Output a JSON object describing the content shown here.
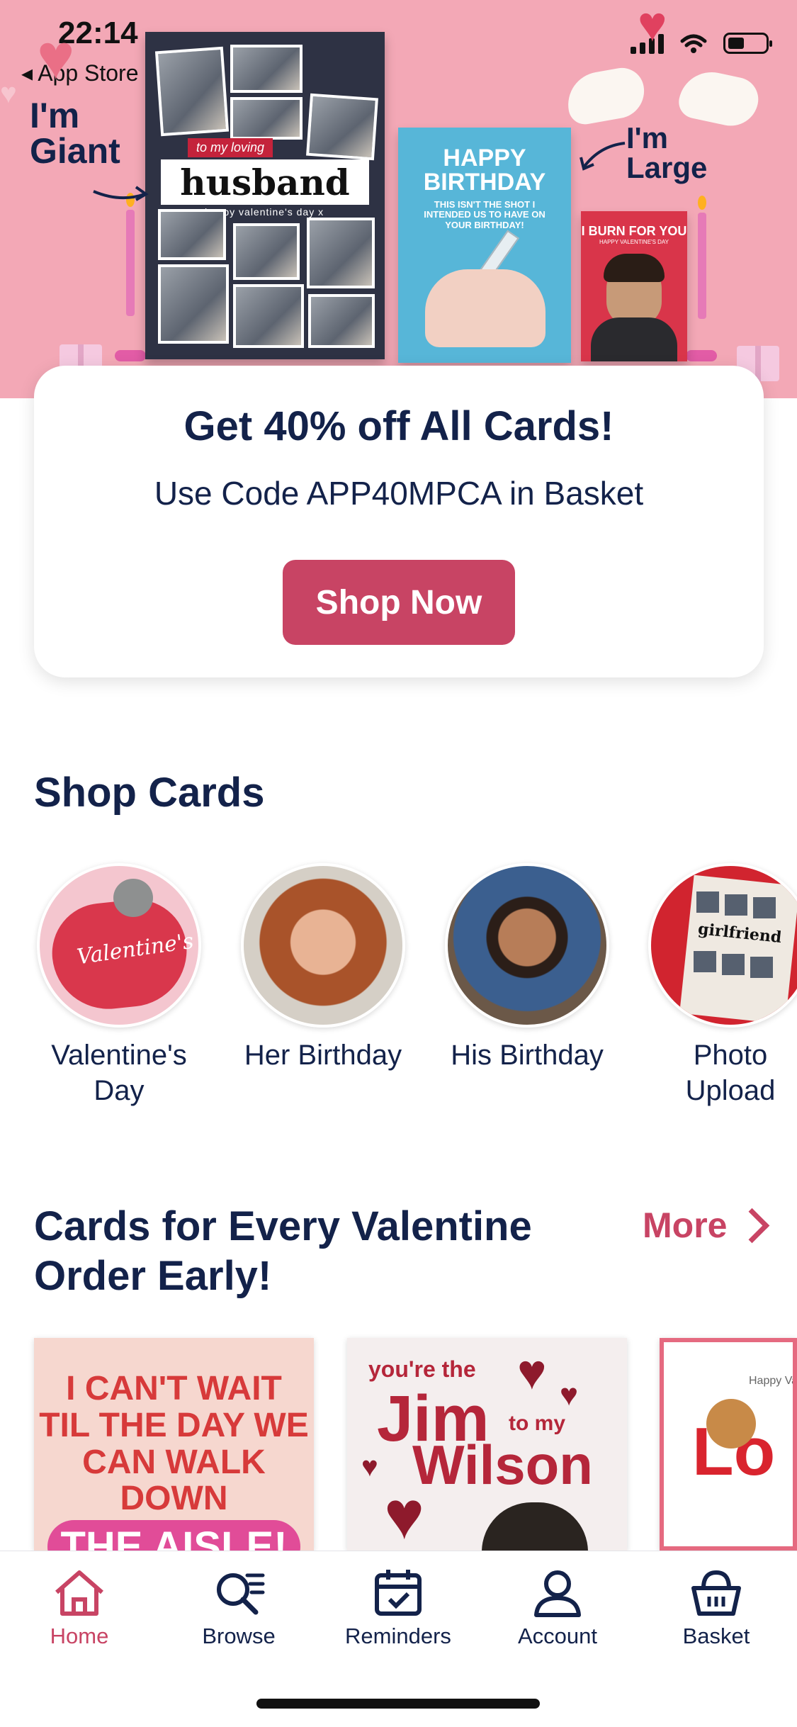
{
  "status_bar": {
    "time": "22:14",
    "back_label": "◂ App Store"
  },
  "hero": {
    "label_giant": "I'm Giant",
    "label_large": "I'm Large",
    "card_husband": {
      "tag": "to my loving",
      "title": "husband",
      "footer": "happy valentine's day x"
    },
    "card_birthday": {
      "title": "HAPPY BIRTHDAY",
      "subtitle": "THIS ISN'T THE SHOT I INTENDED US TO HAVE ON YOUR BIRTHDAY!"
    },
    "card_burn": {
      "title": "I BURN FOR YOU",
      "subtitle": "HAPPY VALENTINE'S DAY"
    }
  },
  "promo": {
    "title": "Get 40% off All Cards!",
    "subtitle": "Use Code APP40MPCA in Basket",
    "button_label": "Shop Now"
  },
  "shop_cards": {
    "title": "Shop Cards",
    "categories": [
      {
        "label": "Valentine's Day",
        "image_text": "Valentine's"
      },
      {
        "label": "Her Birthday"
      },
      {
        "label": "His Birthday"
      },
      {
        "label": "Photo Upload",
        "image_text": "girlfriend"
      }
    ]
  },
  "valentine_section": {
    "title_line1": "Cards for Every Valentine",
    "title_line2": "Order Early!",
    "more_label": "More",
    "cards": [
      {
        "lines": [
          "I CAN'T WAIT",
          "TIL THE DAY WE",
          "CAN WALK DOWN"
        ],
        "highlight": "THE AISLE!"
      },
      {
        "top": "you're the",
        "name1": "Jim",
        "mid": "to my",
        "name2": "Wilson"
      },
      {
        "top": "Happy Vale",
        "big": "Lo"
      }
    ]
  },
  "tabbar": {
    "tabs": [
      {
        "label": "Home",
        "icon": "home-icon",
        "active": true
      },
      {
        "label": "Browse",
        "icon": "browse-icon"
      },
      {
        "label": "Reminders",
        "icon": "calendar-icon"
      },
      {
        "label": "Account",
        "icon": "account-icon"
      },
      {
        "label": "Basket",
        "icon": "basket-icon"
      }
    ]
  },
  "colors": {
    "accent": "#c84464",
    "navy": "#13224a",
    "hero_bg": "#f3a8b6"
  }
}
